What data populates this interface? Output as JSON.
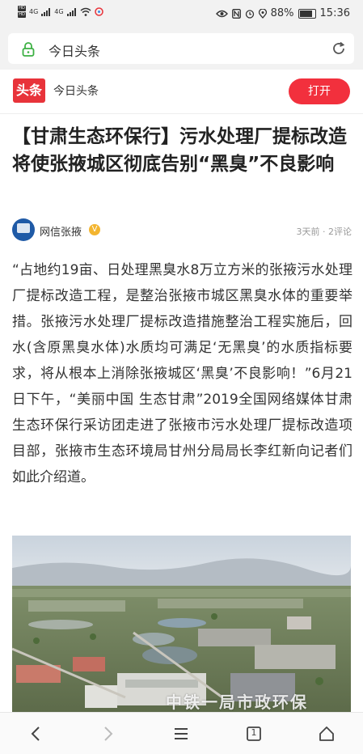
{
  "status_bar": {
    "hd_labels": [
      "HD",
      "HD"
    ],
    "signal_label_1": "4G",
    "signal_label_2": "4G",
    "battery_text": "88%",
    "time": "15:36"
  },
  "browser": {
    "url_title": "今日头条"
  },
  "app_banner": {
    "logo_text": "头条",
    "app_name": "今日头条",
    "open_label": "打开"
  },
  "article": {
    "title": "【甘肃生态环保行】污水处理厂提标改造将使张掖城区彻底告别“黑臭”不良影响",
    "author": "网信张掖",
    "verified_mark": "V",
    "meta": "3天前 · 2评论",
    "body": "“占地约19亩、日处理黑臭水8万立方米的张掖污水处理厂提标改造工程，是整治张掖市城区黑臭水体的重要举措。张掖污水处理厂提标改造措施整治工程实施后，回水(含原黑臭水体)水质均可满足‘无黑臭’的水质指标要求，将从根本上消除张掖城区‘黑臭’不良影响！”6月21日下午，“美丽中国 生态甘肃”2019全国网络媒体甘肃生态环保行采访团走进了张掖市污水处理厂提标改造项目部，张掖市生态环境局甘州分局局长李红新向记者们如此介绍道。",
    "photo_watermark": "中铁一局市政环保"
  },
  "colors": {
    "accent_red": "#f2303d",
    "logo_red": "#e8333a",
    "lock_green": "#3cb043",
    "verified_gold": "#f3b530"
  },
  "icons": {
    "lock": "lock-icon",
    "refresh": "refresh-icon",
    "back": "back-arrow-icon",
    "forward": "forward-arrow-icon",
    "menu": "menu-icon",
    "tabs": "tabs-icon",
    "home": "home-icon"
  },
  "bottom_nav": {
    "tab_count": "1"
  }
}
